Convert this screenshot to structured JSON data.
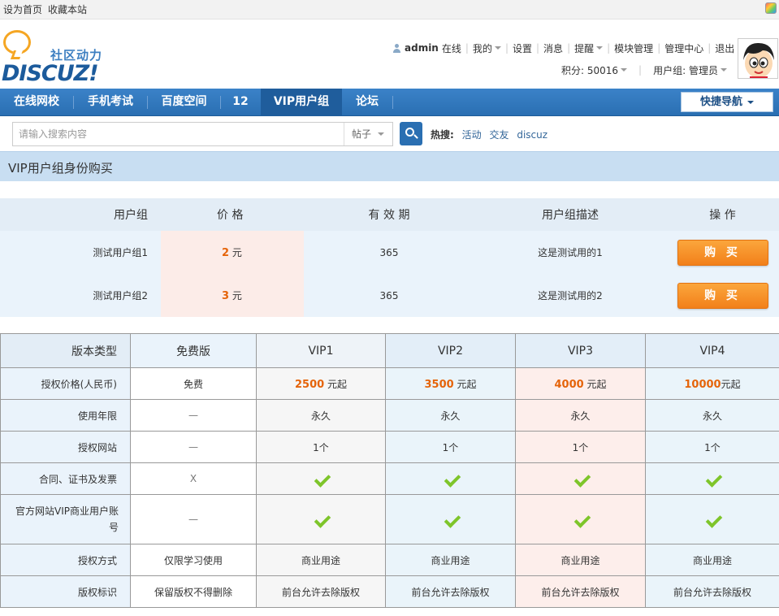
{
  "topbar": {
    "set_home": "设为首页",
    "bookmark": "收藏本站"
  },
  "logo": {
    "slogan": "社区动力",
    "word": "DISCUZ!"
  },
  "user": {
    "name": "admin",
    "status": "在线",
    "links": [
      "我的",
      "设置",
      "消息",
      "提醒",
      "模块管理",
      "管理中心",
      "退出"
    ],
    "points_label": "积分: 50016",
    "group_label": "用户组: 管理员"
  },
  "nav": {
    "items": [
      "在线网校",
      "手机考试",
      "百度空间",
      "12",
      "VIP用户组",
      "论坛"
    ],
    "active": "VIP用户组",
    "quick_nav": "快捷导航"
  },
  "search": {
    "placeholder": "请输入搜索内容",
    "type": "帖子",
    "hot_label": "热搜:",
    "hot_words": [
      "活动",
      "交友",
      "discuz"
    ]
  },
  "page_title": "VIP用户组身份购买",
  "group_table": {
    "headers": [
      "用户组",
      "价 格",
      "有 效 期",
      "用户组描述",
      "操 作"
    ],
    "rows": [
      {
        "name": "测试用户组1",
        "price": "2",
        "unit": "元",
        "period": "365",
        "desc": "这是测试用的1",
        "action": "购 买"
      },
      {
        "name": "测试用户组2",
        "price": "3",
        "unit": "元",
        "period": "365",
        "desc": "这是测试用的2",
        "action": "购 买"
      }
    ]
  },
  "version_table": {
    "headers": [
      "版本类型",
      "免费版",
      "VIP1",
      "VIP2",
      "VIP3",
      "VIP4"
    ],
    "rows": [
      {
        "label": "授权价格(人民币)",
        "cells": [
          {
            "text": "免费"
          },
          {
            "num": "2500",
            "suffix": " 元起"
          },
          {
            "num": "3500",
            "suffix": " 元起"
          },
          {
            "num": "4000",
            "suffix": " 元起"
          },
          {
            "num": "10000",
            "suffix": "元起"
          }
        ]
      },
      {
        "label": "使用年限",
        "cells": [
          {
            "text": "—"
          },
          {
            "text": "永久"
          },
          {
            "text": "永久"
          },
          {
            "text": "永久"
          },
          {
            "text": "永久"
          }
        ]
      },
      {
        "label": "授权网站",
        "cells": [
          {
            "text": "—"
          },
          {
            "text": "1个"
          },
          {
            "text": "1个"
          },
          {
            "text": "1个"
          },
          {
            "text": "1个"
          }
        ]
      },
      {
        "label": "合同、证书及发票",
        "cells": [
          {
            "text": "X"
          },
          {
            "icon": "check-icon"
          },
          {
            "icon": "check-icon"
          },
          {
            "icon": "check-icon"
          },
          {
            "icon": "check-icon"
          }
        ]
      },
      {
        "label": "官方网站VIP商业用户账号",
        "cells": [
          {
            "text": "—"
          },
          {
            "icon": "check-icon"
          },
          {
            "icon": "check-icon"
          },
          {
            "icon": "check-icon"
          },
          {
            "icon": "check-icon"
          }
        ]
      },
      {
        "label": "授权方式",
        "cells": [
          {
            "text": "仅限学习使用"
          },
          {
            "text": "商业用途"
          },
          {
            "text": "商业用途"
          },
          {
            "text": "商业用途"
          },
          {
            "text": "商业用途"
          }
        ]
      },
      {
        "label": "版权标识",
        "cells": [
          {
            "text": "保留版权不得删除"
          },
          {
            "text": "前台允许去除版权"
          },
          {
            "text": "前台允许去除版权"
          },
          {
            "text": "前台允许去除版权"
          },
          {
            "text": "前台允许去除版权"
          }
        ]
      }
    ]
  }
}
